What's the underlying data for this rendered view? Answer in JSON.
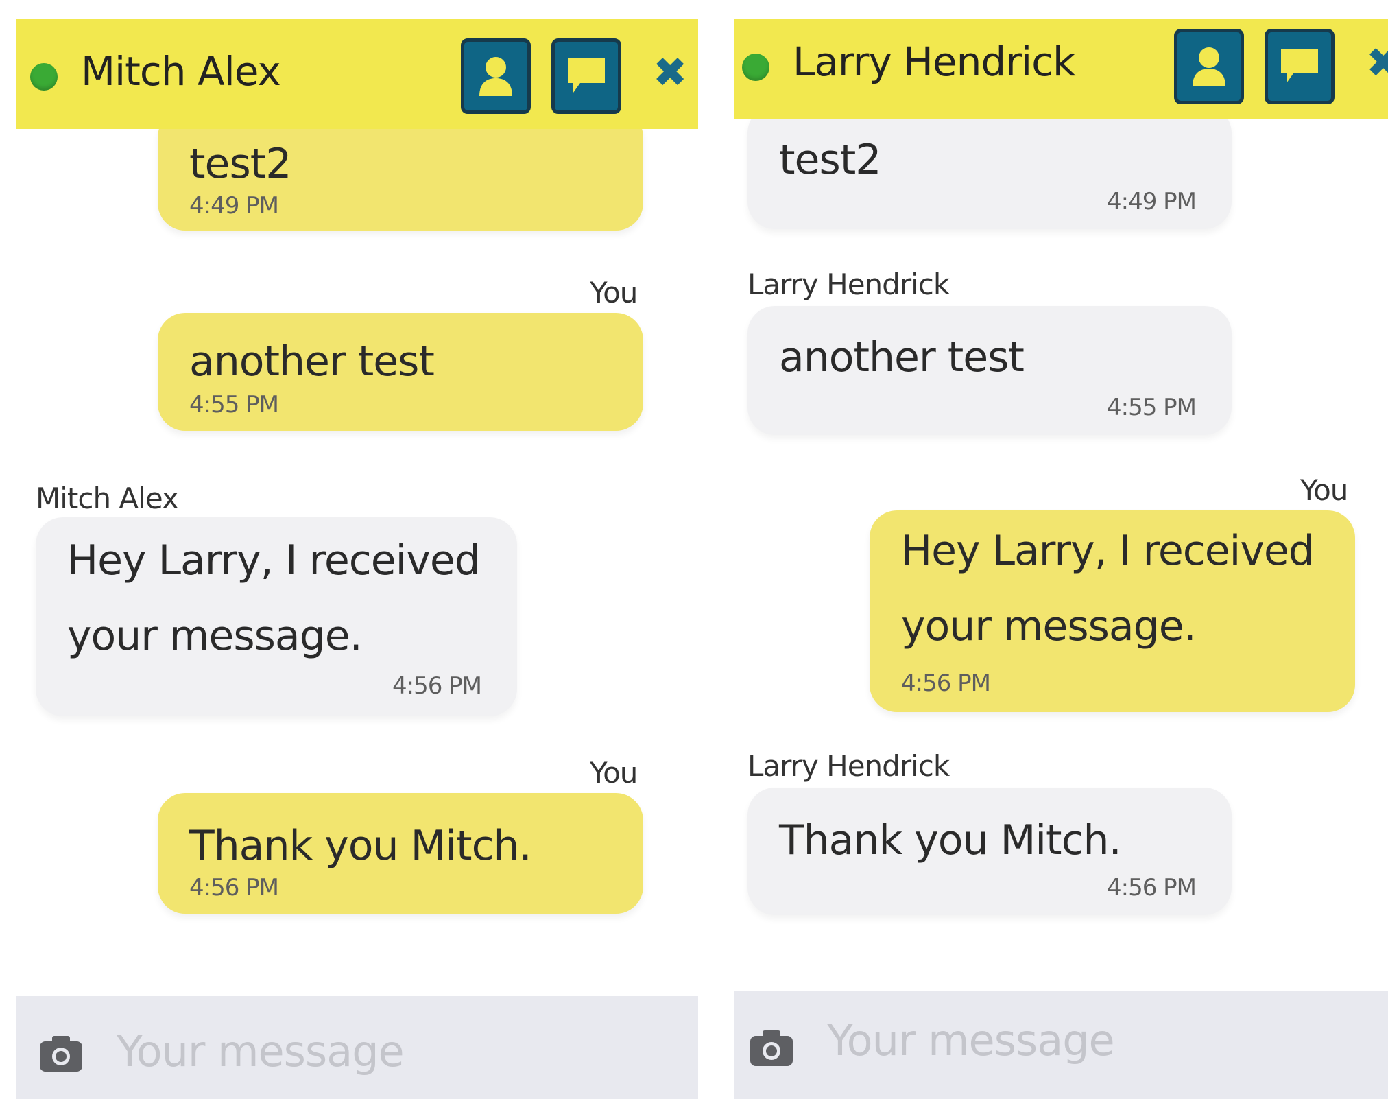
{
  "left_chat": {
    "contact_name": "Mitch Alex",
    "composer_placeholder": "Your message",
    "messages": [
      {
        "sender": "",
        "text": "test2",
        "time": "4:49 PM",
        "mine": true
      },
      {
        "sender": "You",
        "text": "another test",
        "time": "4:55 PM",
        "mine": true
      },
      {
        "sender": "Mitch Alex",
        "text": "Hey Larry, I received your message.",
        "time": "4:56 PM",
        "mine": false
      },
      {
        "sender": "You",
        "text": "Thank you Mitch.",
        "time": "4:56 PM",
        "mine": true
      }
    ]
  },
  "right_chat": {
    "contact_name": "Larry Hendrick",
    "composer_placeholder": "Your message",
    "messages": [
      {
        "sender": "",
        "text": "test2",
        "time": "4:49 PM",
        "mine": false
      },
      {
        "sender": "Larry Hendrick",
        "text": "another test",
        "time": "4:55 PM",
        "mine": false
      },
      {
        "sender": "You",
        "text": "Hey Larry, I received your message.",
        "time": "4:56 PM",
        "mine": true
      },
      {
        "sender": "Larry Hendrick",
        "text": "Thank you Mitch.",
        "time": "4:56 PM",
        "mine": false
      }
    ]
  },
  "icons": {
    "status": "online-status-dot",
    "profile": "user-profile-icon",
    "chat": "speech-bubble-icon",
    "close": "close-icon",
    "camera": "camera-icon"
  },
  "colors": {
    "header_yellow": "#f2e84f",
    "own_bubble": "#f2e56f",
    "other_bubble": "#f1f1f3",
    "button_blue": "#0f6585",
    "online_green": "#3aaa35",
    "composer_bg": "#e8e9ef"
  }
}
